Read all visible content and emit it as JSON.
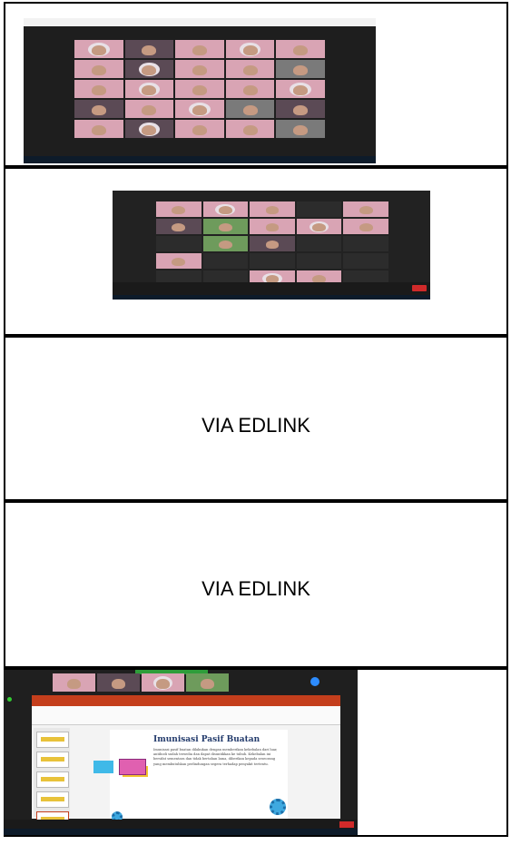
{
  "rows": [
    {
      "id": "row1",
      "content": "screenshot"
    },
    {
      "id": "row2",
      "content": "screenshot"
    },
    {
      "id": "row3",
      "label": "VIA EDLINK"
    },
    {
      "id": "row4",
      "label": "VIA EDLINK"
    },
    {
      "id": "row5",
      "content": "screenshot"
    }
  ],
  "slide": {
    "title": "Imunisasi Pasif Buatan",
    "body": "Imunisasi pasif buatan dilakukan dengan memberikan kekebalan dari luar, antibodi sudah tersedia dan dapat disuntikkan ke tubuh. Kekebalan ini bersifat sementara dan tidak bertahan lama, diberikan kepada seseorang yang membutuhkan perlindungan segera terhadap penyakit tertentu."
  },
  "colors": {
    "border": "#000000",
    "zoom_bg": "#1e1e1e",
    "ppt_accent": "#c43e1c",
    "end_button": "#d02a2a"
  }
}
